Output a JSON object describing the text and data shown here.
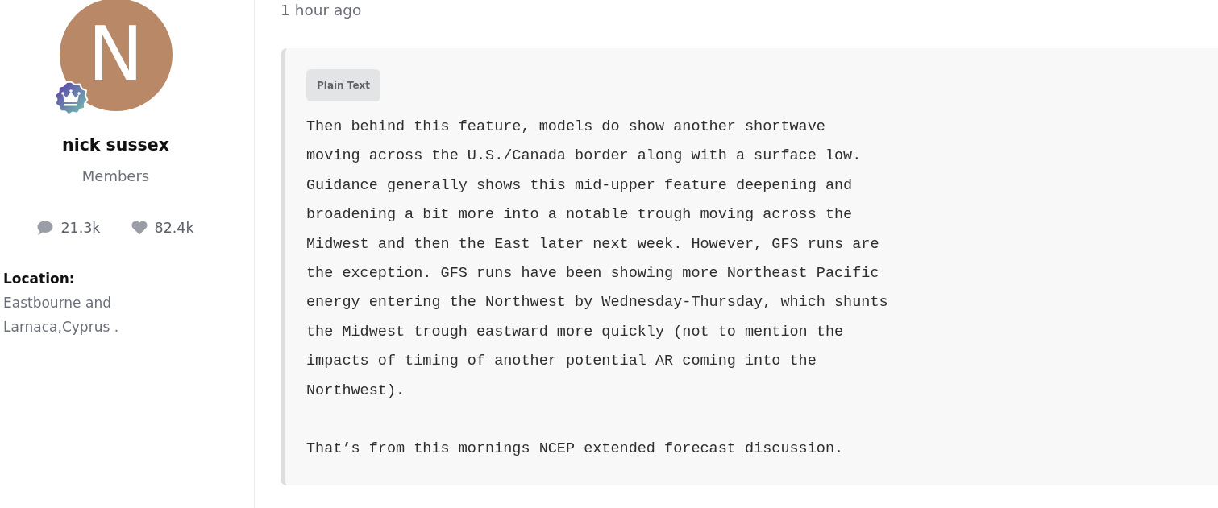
{
  "author": {
    "initial": "N",
    "name": "nick sussex",
    "group": "Members",
    "stats": [
      {
        "kind": "comments",
        "value": "21.3k"
      },
      {
        "kind": "likes",
        "value": "82.4k"
      }
    ],
    "fields": [
      {
        "label": "Location:",
        "value": "Eastbourne and Larnaca,Cyprus ."
      }
    ]
  },
  "post": {
    "time": "1 hour ago",
    "code_block": {
      "language": "Plain Text",
      "paragraphs": [
        "Then behind this feature, models do show another shortwave\nmoving across the U.S./Canada border along with a surface low.\nGuidance generally shows this mid-upper feature deepening and\nbroadening a bit more into a notable trough moving across the\nMidwest and then the East later next week. However, GFS runs are\nthe exception. GFS runs have been showing more Northeast Pacific\nenergy entering the Northwest by Wednesday-Thursday, which shunts\nthe Midwest trough eastward more quickly (not to mention the\nimpacts of timing of another potential AR coming into the\nNorthwest).",
        "That’s from this mornings NCEP extended forecast discussion."
      ]
    }
  }
}
